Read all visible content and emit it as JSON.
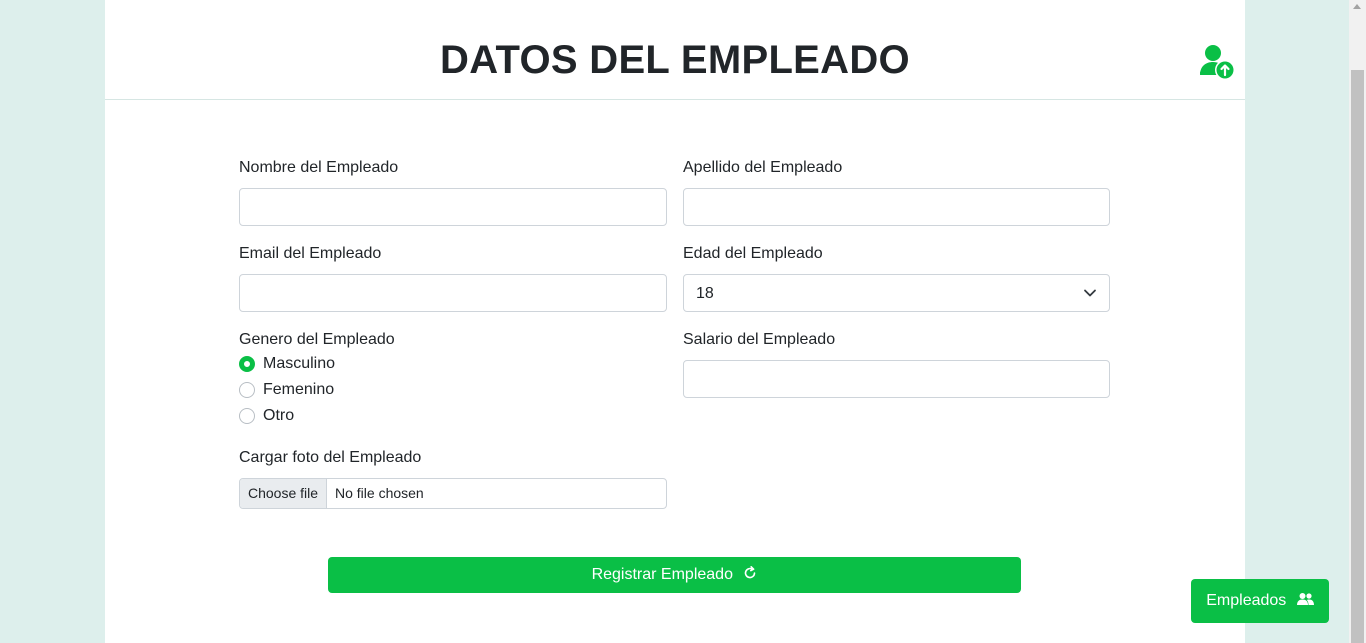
{
  "header": {
    "title": "DATOS DEL EMPLEADO",
    "icon": "user-upload-icon"
  },
  "form": {
    "nombre": {
      "label": "Nombre del Empleado",
      "value": ""
    },
    "apellido": {
      "label": "Apellido del Empleado",
      "value": ""
    },
    "email": {
      "label": "Email del Empleado",
      "value": ""
    },
    "edad": {
      "label": "Edad del Empleado",
      "value": "18"
    },
    "genero": {
      "label": "Genero del Empleado",
      "options": [
        {
          "label": "Masculino",
          "checked": true
        },
        {
          "label": "Femenino",
          "checked": false
        },
        {
          "label": "Otro",
          "checked": false
        }
      ]
    },
    "salario": {
      "label": "Salario del Empleado",
      "value": ""
    },
    "foto": {
      "label": "Cargar foto del Empleado",
      "button": "Choose file",
      "status": "No file chosen"
    },
    "submit": {
      "label": "Registrar Empleado",
      "icon": "refresh-icon"
    }
  },
  "floating_button": {
    "label": "Empleados",
    "icon": "users-icon"
  },
  "colors": {
    "accent": "#0abf46",
    "background": "#ddefec"
  }
}
